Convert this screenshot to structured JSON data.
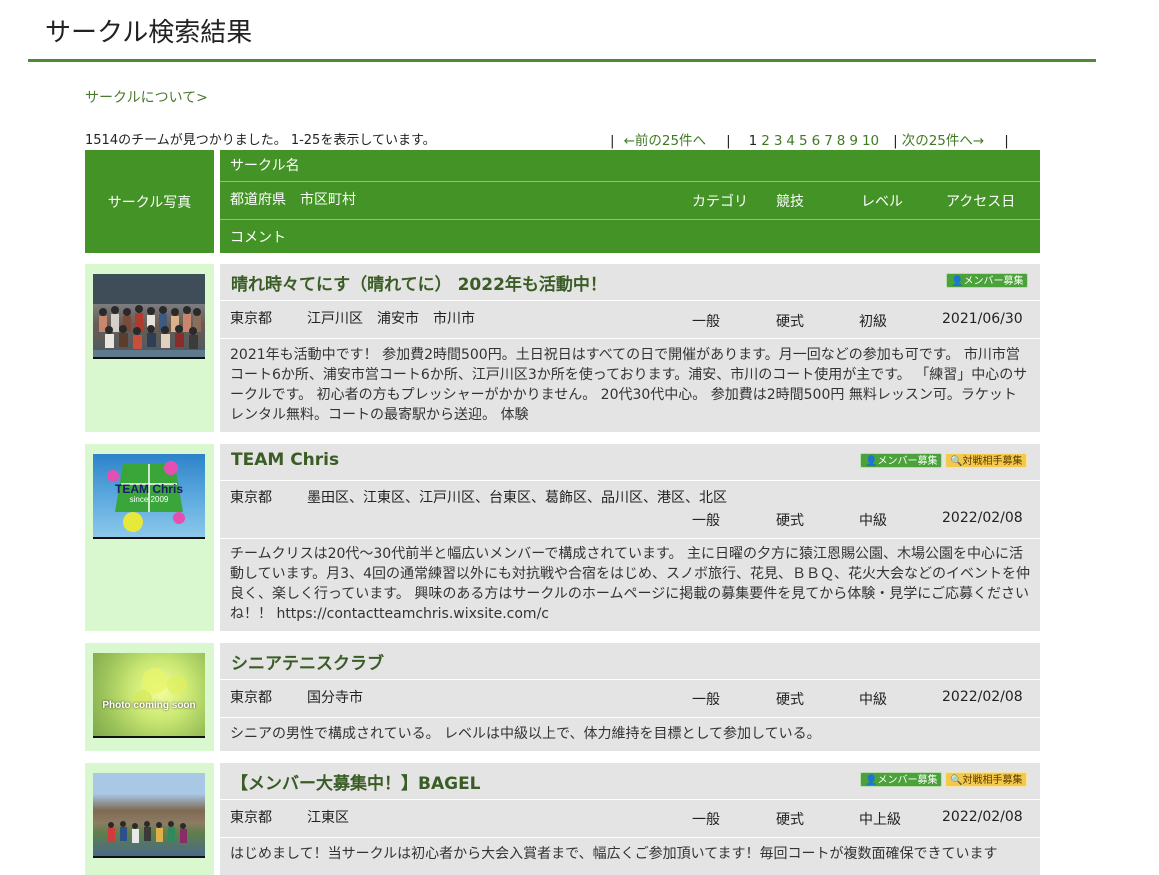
{
  "page": {
    "title": "サークル検索結果"
  },
  "about_link": "サークルについて>",
  "result_count": "1514のチームが見つかりました。 1-25を表示しています。",
  "pager": {
    "prev": "←前の25件へ",
    "pages": [
      "1",
      "2",
      "3",
      "4",
      "5",
      "6",
      "7",
      "8",
      "9",
      "10"
    ],
    "next": "次の25件へ→"
  },
  "header": {
    "photo": "サークル写真",
    "name": "サークル名",
    "location": "都道府県　市区町村",
    "category": "カテゴリ",
    "sport": "競技",
    "level": "レベル",
    "access": "アクセス日",
    "comment": "コメント"
  },
  "badges": {
    "member": "メンバー募集",
    "rival": "対戦相手募集"
  },
  "circles": [
    {
      "name": "晴れ時々てにす（晴れてに） 2022年も活動中！",
      "prefecture": "東京都",
      "city": "江戸川区　浦安市　市川市",
      "category": "一般",
      "sport": "硬式",
      "level": "初級",
      "access": "2021/06/30",
      "comment": "2021年も活動中です！ 参加費2時間500円。土日祝日はすべての日で開催があります。月一回などの参加も可です。 市川市営コート6か所、浦安市営コート6か所、江戸川区3か所を使っております。浦安、市川のコート使用が主です。 「練習」中心のサークルです。 初心者の方もプレッシャーがかかりません。 20代30代中心。 参加費は2時間500円 無料レッスン可。ラケットレンタル無料。コートの最寄駅から送迎。 体験",
      "thumb_text": ""
    },
    {
      "name": "TEAM Chris",
      "prefecture": "東京都",
      "city": "墨田区、江東区、江戸川区、台東区、葛飾区、品川区、港区、北区",
      "category": "一般",
      "sport": "硬式",
      "level": "中級",
      "access": "2022/02/08",
      "comment": "チームクリスは20代〜30代前半と幅広いメンバーで構成されています。 主に日曜の夕方に猿江恩賜公園、木場公園を中心に活動しています。月3、4回の通常練習以外にも対抗戦や合宿をはじめ、スノボ旅行、花見、ＢＢＱ、花火大会などのイベントを仲良く、楽しく行っています。 興味のある方はサークルのホームページに掲載の募集要件を見てから体験・見学にご応募くださいね！！ https://contactteamchris.wixsite.com/c",
      "thumb_text": "TEAM Chris",
      "thumb_sub": "since 2009"
    },
    {
      "name": "シニアテニスクラブ",
      "prefecture": "東京都",
      "city": "国分寺市",
      "category": "一般",
      "sport": "硬式",
      "level": "中級",
      "access": "2022/02/08",
      "comment": "シニアの男性で構成されている。 レベルは中級以上で、体力維持を目標として参加している。",
      "thumb_text": "Photo coming soon"
    },
    {
      "name": "【メンバー大募集中！】BAGEL",
      "prefecture": "東京都",
      "city": "江東区",
      "category": "一般",
      "sport": "硬式",
      "level": "中上級",
      "access": "2022/02/08",
      "comment": "はじめまして！当サークルは初心者から大会入賞者まで、幅広くご参加頂いてます！毎回コートが複数面確保できています",
      "thumb_text": ""
    }
  ]
}
